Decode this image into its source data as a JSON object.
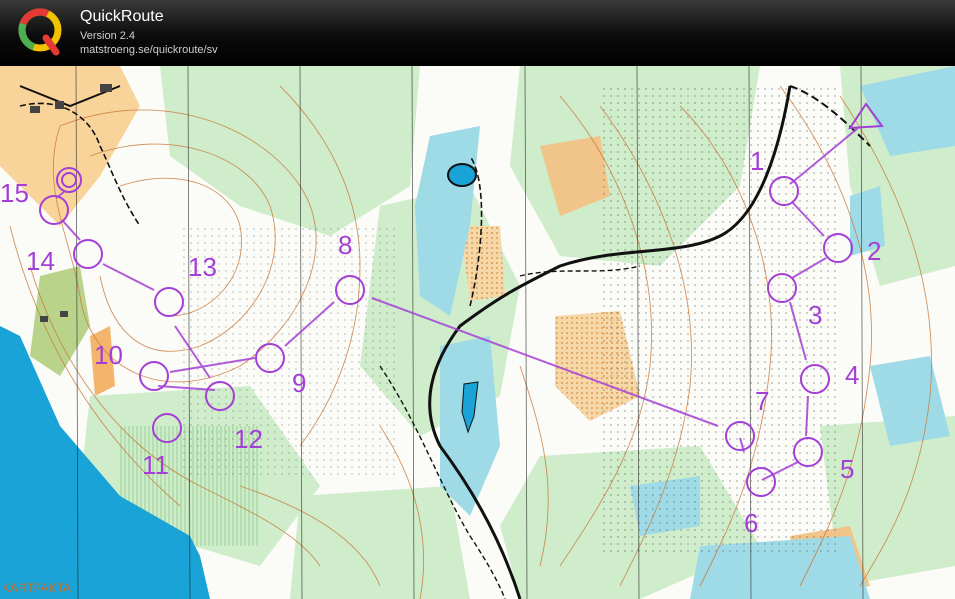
{
  "app": {
    "title": "QuickRoute",
    "version": "Version 2.4",
    "url": "matstroeng.se/quickroute/sv"
  },
  "map": {
    "legend_label": "KARTFAKTA",
    "course_color": "#a43fd6",
    "controls": [
      {
        "id": "start",
        "label": ""
      },
      {
        "id": "c1",
        "label": "1"
      },
      {
        "id": "c2",
        "label": "2"
      },
      {
        "id": "c3",
        "label": "3"
      },
      {
        "id": "c4",
        "label": "4"
      },
      {
        "id": "c5",
        "label": "5"
      },
      {
        "id": "c6",
        "label": "6"
      },
      {
        "id": "c7",
        "label": "7"
      },
      {
        "id": "c8",
        "label": "8"
      },
      {
        "id": "c9",
        "label": "9"
      },
      {
        "id": "c10",
        "label": "10"
      },
      {
        "id": "c11",
        "label": "11"
      },
      {
        "id": "c12",
        "label": "12"
      },
      {
        "id": "c13",
        "label": "13"
      },
      {
        "id": "c14",
        "label": "14"
      },
      {
        "id": "c15",
        "label": "15"
      },
      {
        "id": "finish",
        "label": ""
      }
    ]
  }
}
